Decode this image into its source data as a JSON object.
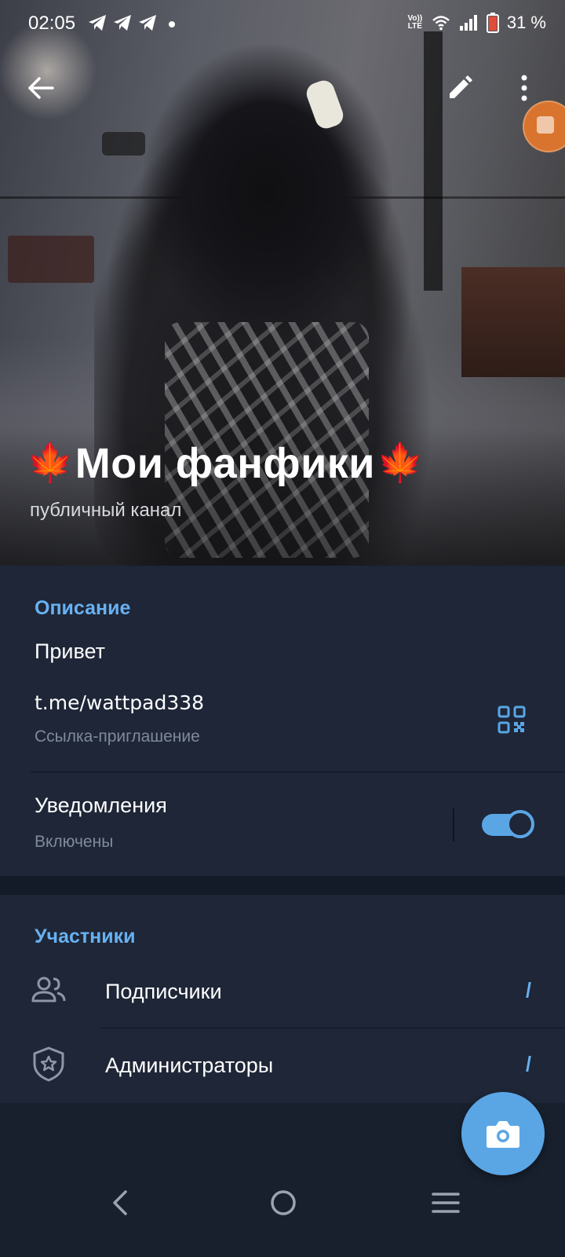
{
  "status_bar": {
    "time": "02:05",
    "network_label": "Vo)) LTE",
    "battery_percent": "31 %"
  },
  "header": {
    "back_icon": "arrow-left-icon",
    "edit_icon": "pencil-icon",
    "more_icon": "more-vertical-icon"
  },
  "channel": {
    "title_prefix_emoji": "🍁",
    "title": "Мои фанфики",
    "title_suffix_emoji": "🍁",
    "subtitle": "публичный канал"
  },
  "info": {
    "section_title": "Описание",
    "description": "Привет",
    "link": "t.me/wattpad338",
    "link_caption": "Ссылка-приглашение",
    "notifications_label": "Уведомления",
    "notifications_status": "Включены",
    "notifications_enabled": true
  },
  "members": {
    "section_title": "Участники",
    "rows": [
      {
        "icon": "users-icon",
        "label": "Подписчики",
        "count": "1"
      },
      {
        "icon": "shield-star-icon",
        "label": "Администраторы",
        "count": "1"
      }
    ]
  },
  "fab": {
    "icon": "camera-icon"
  },
  "nav_bar": {
    "back_icon": "nav-back-icon",
    "home_icon": "nav-home-icon",
    "menu_icon": "nav-recents-icon"
  },
  "colors": {
    "accent": "#5aa6e5",
    "section_header": "#68b1f0",
    "card_bg": "#1e2637",
    "page_bg": "#18202e"
  }
}
